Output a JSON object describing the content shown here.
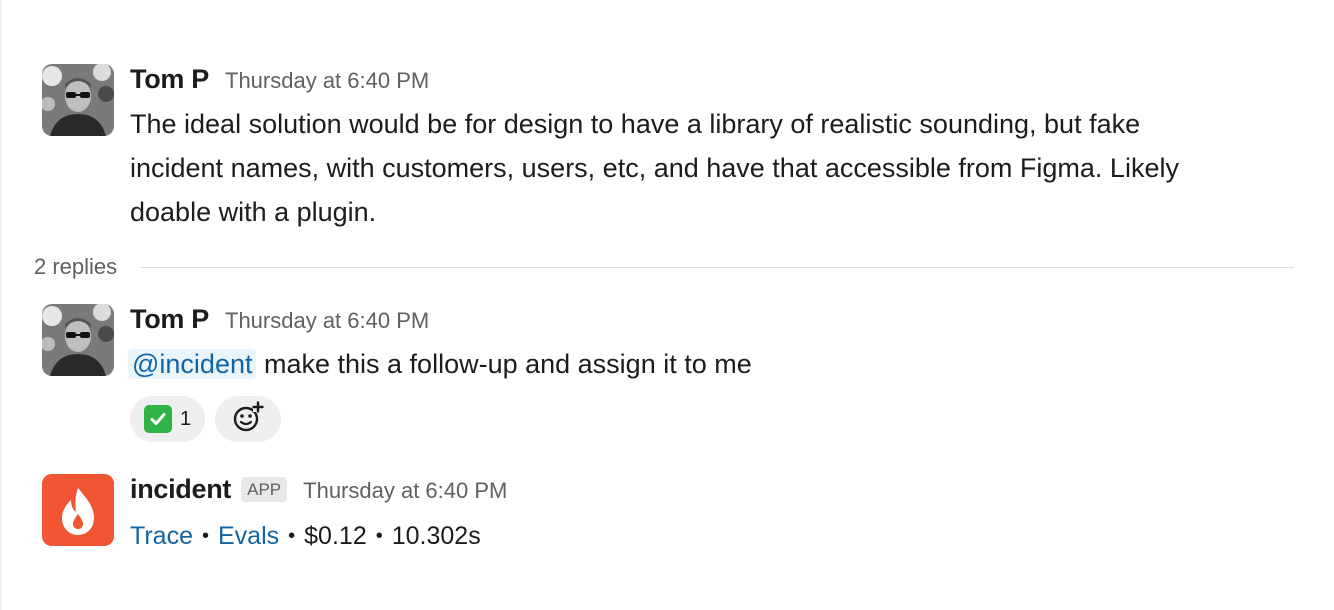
{
  "messages": [
    {
      "author": "Tom P",
      "timestamp": "Thursday at 6:40 PM",
      "lines": [
        "The ideal solution would be for design to have a library of realistic sounding, but fake",
        "incident names, with customers, users, etc, and have that accessible from Figma. Likely",
        "doable with a plugin."
      ]
    },
    {
      "author": "Tom P",
      "timestamp": "Thursday at 6:40 PM",
      "mention": "@incident",
      "text": "make this a follow-up and assign it to me",
      "reactions": [
        {
          "emoji": "white-check-mark",
          "count": "1"
        }
      ]
    },
    {
      "author": "incident",
      "badge": "APP",
      "timestamp": "Thursday at 6:40 PM",
      "meta": {
        "trace": "Trace",
        "evals": "Evals",
        "cost": "$0.12",
        "duration": "10.302s",
        "separator": "•"
      }
    }
  ],
  "thread": {
    "replies_label": "2 replies"
  },
  "colors": {
    "link": "#1264a3",
    "incident_brand": "#f25533",
    "check_green": "#2eb344"
  }
}
